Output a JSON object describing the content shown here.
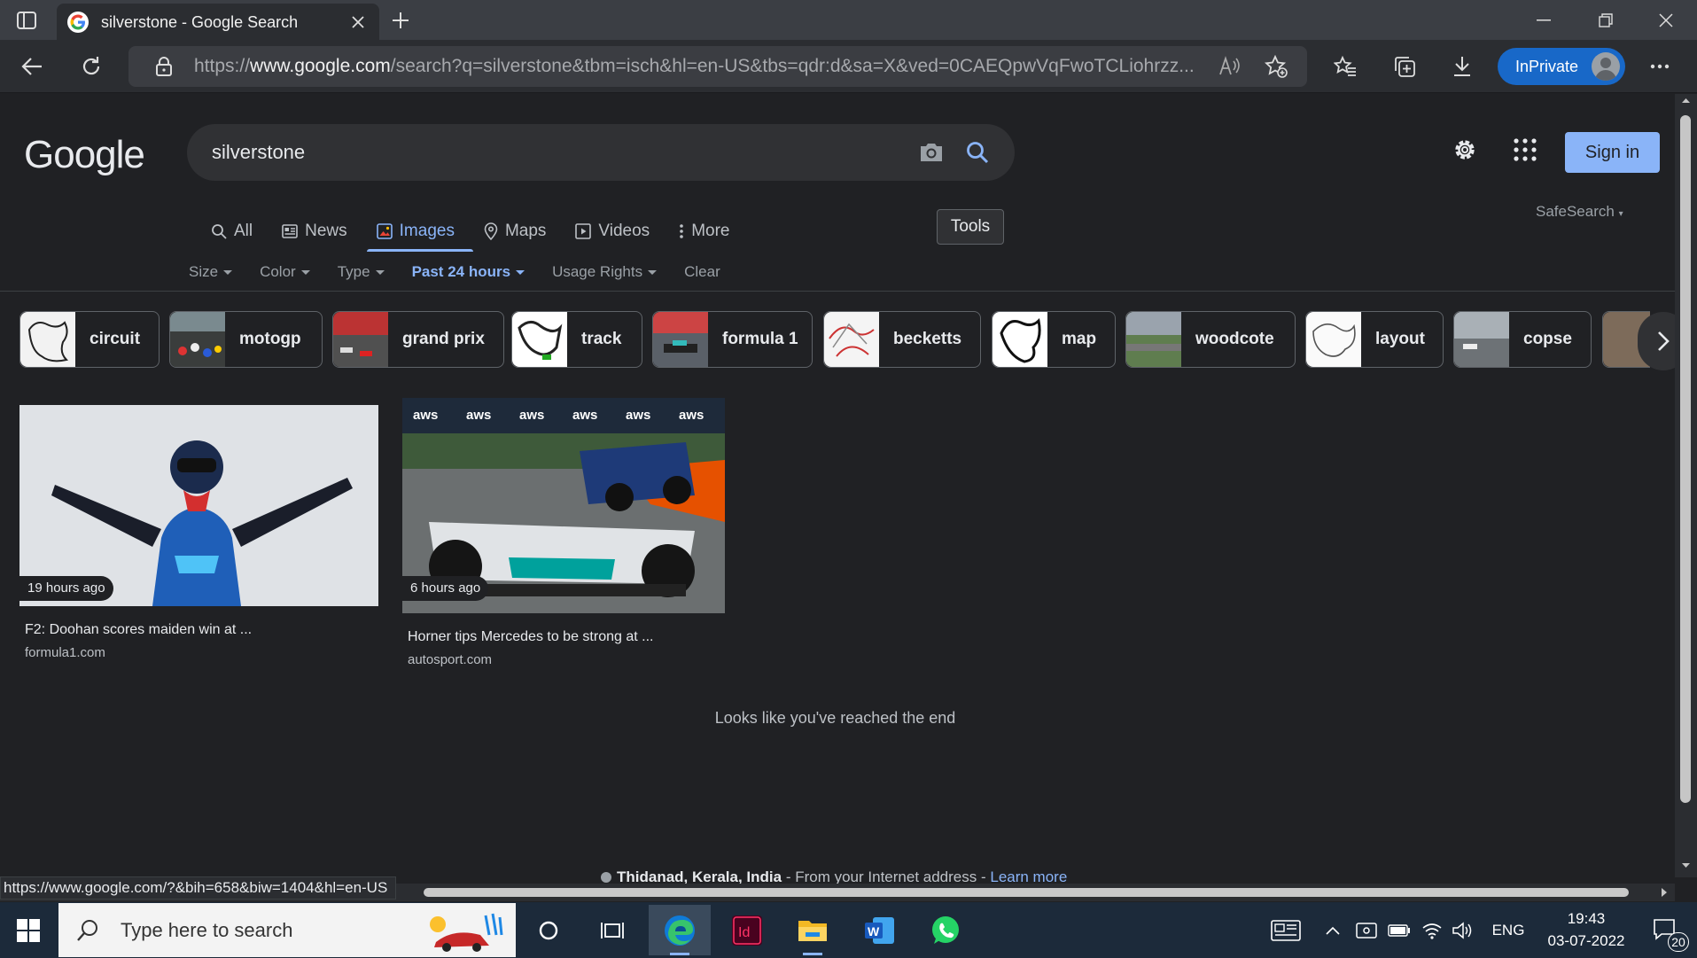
{
  "browser": {
    "tab_title": "silverstone - Google Search",
    "url_prefix": "https://",
    "url_host": "www.google.com",
    "url_path": "/search?q=silverstone&tbm=isch&hl=en-US&tbs=qdr:d&sa=X&ved=0CAEQpwVqFwoTCLiohrzz...",
    "inprivate_label": "InPrivate"
  },
  "google": {
    "logo": "Google",
    "query": "silverstone",
    "signin_label": "Sign in",
    "tabs": [
      {
        "label": "All",
        "icon": "search-icon"
      },
      {
        "label": "News",
        "icon": "news-icon"
      },
      {
        "label": "Images",
        "icon": "image-icon",
        "active": true
      },
      {
        "label": "Maps",
        "icon": "pin-icon"
      },
      {
        "label": "Videos",
        "icon": "video-icon"
      },
      {
        "label": "More",
        "icon": "kebab-icon"
      }
    ],
    "tools_label": "Tools",
    "safesearch_label": "SafeSearch",
    "filters": [
      {
        "label": "Size"
      },
      {
        "label": "Color"
      },
      {
        "label": "Type"
      },
      {
        "label": "Past 24 hours",
        "active": true
      },
      {
        "label": "Usage Rights"
      },
      {
        "label": "Clear"
      }
    ],
    "chips": [
      "circuit",
      "motogp",
      "grand prix",
      "track",
      "formula 1",
      "becketts",
      "map",
      "woodcote",
      "layout",
      "copse"
    ],
    "results": [
      {
        "ago": "19 hours ago",
        "caption": "F2: Doohan scores maiden win at ...",
        "source": "formula1.com"
      },
      {
        "ago": "6 hours ago",
        "caption": "Horner tips Mercedes to be strong at ...",
        "source": "autosport.com"
      }
    ],
    "end_message": "Looks like you've reached the end",
    "location": {
      "place": "Thidanad, Kerala, India",
      "text": " - From your Internet address - ",
      "learn_more": "Learn more"
    }
  },
  "status_url": "https://www.google.com/?&bih=658&biw=1404&hl=en-US",
  "taskbar": {
    "search_placeholder": "Type here to search",
    "language": "ENG",
    "time": "19:43",
    "date": "03-07-2022",
    "notifications": "20"
  },
  "colors": {
    "accent": "#8ab4f8",
    "page_bg": "#202124",
    "inprivate": "#1868c8"
  }
}
